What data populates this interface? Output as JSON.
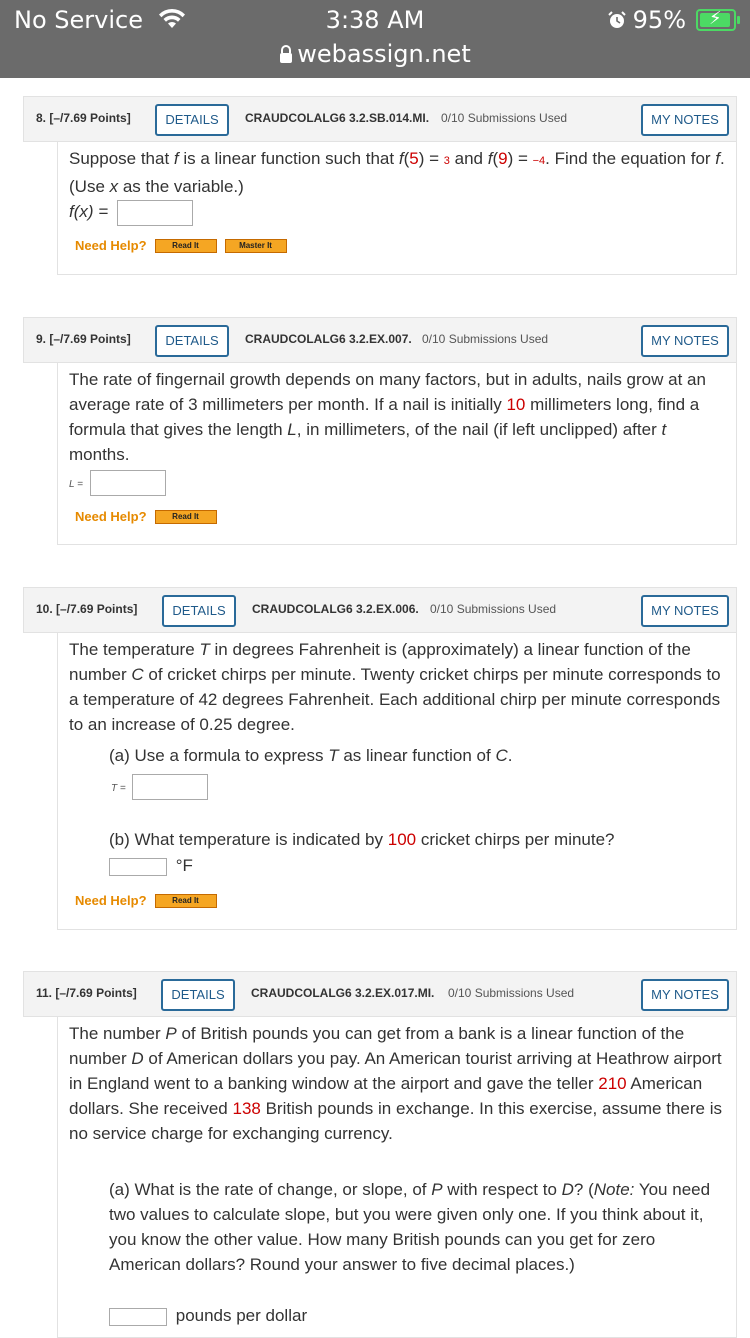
{
  "status": {
    "carrier": "No Service",
    "time": "3:38 AM",
    "url": "webassign.net",
    "battery": "95%"
  },
  "q8": {
    "num": "8.",
    "points": "[–/7.69 Points]",
    "details": "DETAILS",
    "code": "CRAUDCOLALG6 3.2.SB.014.MI.",
    "subs": "0/10 Submissions Used",
    "notes": "MY NOTES",
    "t1": "Suppose that ",
    "f": "f",
    "t2": " is a linear function such that ",
    "fa": "f",
    "p1": "(",
    "v5": "5",
    "p2": ") = ",
    "v3": "3",
    "t3": " and ",
    "fb": "f",
    "p3": "(",
    "v9": "9",
    "p4": ") = ",
    "vneg4": "−4",
    "t4": ". Find the equation for ",
    "f2": "f",
    "t5": ". (Use ",
    "x": "x",
    "t6": " as the variable.)",
    "label": "f(x) =",
    "help": "Need Help?",
    "read": "Read It",
    "master": "Master It"
  },
  "q9": {
    "num": "9.",
    "points": "[–/7.69 Points]",
    "details": "DETAILS",
    "code": "CRAUDCOLALG6 3.2.EX.007.",
    "subs": "0/10 Submissions Used",
    "notes": "MY NOTES",
    "t1": "The rate of fingernail growth depends on many factors, but in adults, nails grow at an average rate of 3 millimeters per month. If a nail is initially ",
    "v10": "10",
    "t2": " millimeters long, find a formula that gives the length ",
    "L": "L",
    "t3": ", in millimeters, of the nail (if left unclipped) after ",
    "t": "t",
    "t4": " months.",
    "label": "L =",
    "help": "Need Help?",
    "read": "Read It"
  },
  "q10": {
    "num": "10.",
    "points": "[–/7.69 Points]",
    "details": "DETAILS",
    "code": "CRAUDCOLALG6 3.2.EX.006.",
    "subs": "0/10 Submissions Used",
    "notes": "MY NOTES",
    "t1": "The temperature ",
    "T": "T",
    "t2": " in degrees Fahrenheit is (approximately) a linear function of the number ",
    "C": "C",
    "t3": " of cricket chirps per minute. Twenty cricket chirps per minute corresponds to a temperature of 42 degrees Fahrenheit. Each additional chirp per minute corresponds to an increase of 0.25 degree.",
    "a1": "(a) Use a formula to express ",
    "aT": "T",
    "a2": " as linear function of ",
    "aC": "C",
    "a3": ".",
    "alabel": "T =",
    "b1": "(b) What temperature is indicated by ",
    "v100": "100",
    "b2": " cricket chirps per minute?",
    "unit": "°F",
    "help": "Need Help?",
    "read": "Read It"
  },
  "q11": {
    "num": "11.",
    "points": "[–/7.69 Points]",
    "details": "DETAILS",
    "code": "CRAUDCOLALG6 3.2.EX.017.MI.",
    "subs": "0/10 Submissions Used",
    "notes": "MY NOTES",
    "t1": "The number ",
    "P": "P",
    "t2": " of British pounds you can get from a bank is a linear function of the number ",
    "D": "D",
    "t3": " of American dollars you pay. An American tourist arriving at Heathrow airport in England went to a banking window at the airport and gave the teller ",
    "v210": "210",
    "t4": " American dollars. She received ",
    "v138": "138",
    "t5": " British pounds in exchange. In this exercise, assume there is no service charge for exchanging currency.",
    "a1": "(a) What is the rate of change, or slope, of ",
    "aP": "P",
    "a2": " with respect to ",
    "aD": "D",
    "a3": "? (",
    "note": "Note:",
    "a4": " You need two values to calculate slope, but you were given only one. If you think about it, you know the other value. How many British pounds can you get for zero American dollars? Round your answer to five decimal places.)",
    "unit": "pounds per dollar"
  }
}
